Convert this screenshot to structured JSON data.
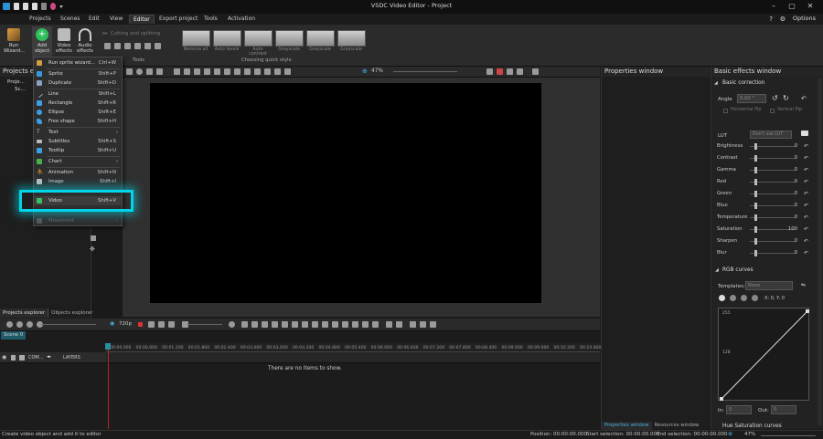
{
  "app": {
    "title": "VSDC Video Editor - Project",
    "options_label": "Options"
  },
  "menu": [
    "Projects",
    "Scenes",
    "Edit",
    "View",
    "Editor",
    "Export project",
    "Tools",
    "Activation"
  ],
  "ribbon": {
    "run_wizard": "Run Wizard...",
    "add_object": "Add object",
    "video_effects": "Video effects",
    "audio_effects": "Audio effects",
    "cutting_splitting": "Cutting and splitting",
    "tools_label": "Tools",
    "quick_style_label": "Choosing quick style",
    "quick_styles": [
      "Remove all",
      "Auto levels",
      "Auto contrast",
      "Grayscale",
      "Grayscale",
      "Grayscale"
    ]
  },
  "projects_explorer": {
    "title": "Projects explorer",
    "item1": "Proje...",
    "item2": "Sc...",
    "tabs": [
      "Projects explorer",
      "Objects explorer"
    ]
  },
  "add_menu": {
    "items": [
      {
        "label": "Run sprite wizard...",
        "shortcut": "Ctrl+W",
        "icon": "wand-icon",
        "color": "#d0a040"
      },
      {
        "label": "Sprite",
        "shortcut": "Shift+P",
        "icon": "sprite-icon",
        "color": "#3a9ad9"
      },
      {
        "label": "Duplicate",
        "shortcut": "Shift+D",
        "icon": "duplicate-icon",
        "color": "#8aa0c0"
      },
      {
        "label": "Line",
        "shortcut": "Shift+L",
        "icon": "line-icon",
        "color": "#9ad0ff"
      },
      {
        "label": "Rectangle",
        "shortcut": "Shift+R",
        "icon": "rectangle-icon",
        "color": "#3aa0e0"
      },
      {
        "label": "Ellipse",
        "shortcut": "Shift+E",
        "icon": "ellipse-icon",
        "color": "#3aa0e0"
      },
      {
        "label": "Free shape",
        "shortcut": "Shift+H",
        "icon": "free-shape-icon",
        "color": "#3aa0e0"
      },
      {
        "label": "Text",
        "shortcut": "",
        "icon": "text-icon",
        "color": "#bbbbbb"
      },
      {
        "label": "Subtitles",
        "shortcut": "Shift+S",
        "icon": "subtitles-icon",
        "color": "#bbbbbb"
      },
      {
        "label": "Tooltip",
        "shortcut": "Shift+U",
        "icon": "tooltip-icon",
        "color": "#3aa0e0"
      },
      {
        "label": "Chart",
        "shortcut": "",
        "icon": "chart-icon",
        "color": "#4ab04a"
      },
      {
        "label": "Animation",
        "shortcut": "Shift+N",
        "icon": "animation-icon",
        "color": "#bbbbbb"
      },
      {
        "label": "Image",
        "shortcut": "Shift+I",
        "icon": "image-icon",
        "color": "#bbbbbb"
      },
      {
        "label": "Video",
        "shortcut": "Shift+V",
        "icon": "video-icon",
        "color": "#3ac060"
      },
      {
        "label": "Movement",
        "shortcut": "",
        "icon": "movement-icon",
        "color": "#666666"
      }
    ]
  },
  "canvas": {
    "zoom": "47%"
  },
  "properties_window": {
    "title": "Properties window"
  },
  "effects": {
    "title": "Basic effects window",
    "basic_correction": "Basic correction",
    "angle_label": "Angle",
    "angle_value": "0.00 °",
    "horizontal_flip": "Horizontal flip",
    "vertical_flip": "Vertical flip",
    "lut_label": "LUT",
    "lut_value": "Don't use LUT",
    "rows": [
      {
        "label": "Brightness",
        "value": "0",
        "pos": 0.5
      },
      {
        "label": "Contrast",
        "value": "0",
        "pos": 0.5
      },
      {
        "label": "Gamma",
        "value": "0",
        "pos": 0.5
      },
      {
        "label": "Red",
        "value": "0",
        "pos": 0.5
      },
      {
        "label": "Green",
        "value": "0",
        "pos": 0.5
      },
      {
        "label": "Blue",
        "value": "0",
        "pos": 0.5
      },
      {
        "label": "Temperature",
        "value": "0",
        "pos": 0.5
      },
      {
        "label": "Saturation",
        "value": "100",
        "pos": 0.5
      },
      {
        "label": "Sharpen",
        "value": "0",
        "pos": 0.5
      },
      {
        "label": "Blur",
        "value": "0",
        "pos": 0.5
      }
    ],
    "rgb_curves": "RGB curves",
    "templates_label": "Templates:",
    "templates_value": "None",
    "coords": "X: 0, Y: 0",
    "curve_top": "255",
    "curve_mid": "128",
    "in_label": "In:",
    "in_value": "0",
    "out_label": "Out:",
    "out_value": "0",
    "hue_saturation": "Hue Saturation curves"
  },
  "bottom_tabs": [
    "Properties window",
    "Resources window"
  ],
  "timeline": {
    "resolution": "720p",
    "scene_tab": "Scene 0",
    "com_label": "COM...",
    "layers_label": "LAYERS",
    "empty_message": "There are no items to show.",
    "ticks": [
      "00:00.000",
      "00:00.600",
      "00:01.200",
      "00:01.800",
      "00:02.400",
      "00:03.000",
      "00:03.600",
      "00:04.200",
      "00:04.800",
      "00:05.400",
      "00:06.000",
      "00:06.600",
      "00:07.200",
      "00:07.800",
      "00:08.400",
      "00:09.000",
      "00:09.600",
      "00:10.200",
      "00:10.800"
    ]
  },
  "status": {
    "hint": "Create video object and add it to editor",
    "position": "Position:  00:00:00.000",
    "start_selection": "Start selection:  00:00:00.000",
    "end_selection": "End selection:  00:00:00.000",
    "zoom": "47%"
  }
}
